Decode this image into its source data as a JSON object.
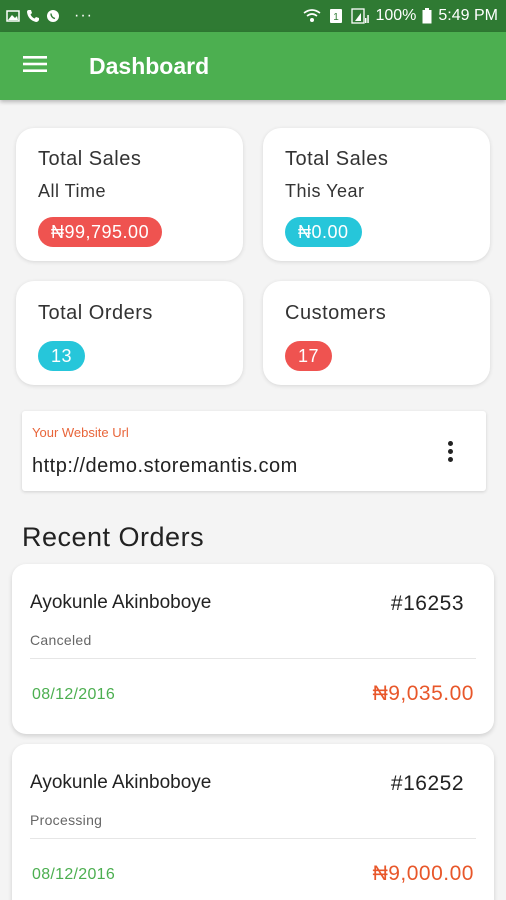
{
  "status_bar": {
    "icons_left": [
      "image-icon",
      "phone-icon",
      "whatsapp-icon"
    ],
    "dots": "···",
    "battery": "100%",
    "time": "5:49 PM"
  },
  "app_bar": {
    "title": "Dashboard",
    "menu_icon": "hamburger-icon"
  },
  "stats": {
    "total_sales_all": {
      "title": "Total Sales",
      "subtitle": "All Time",
      "value": "₦99,795.00",
      "color": "#ef5350"
    },
    "total_sales_year": {
      "title": "Total Sales",
      "subtitle": "This Year",
      "value": "₦0.00",
      "color": "#26c6da"
    },
    "total_orders": {
      "title": "Total Orders",
      "value": "13",
      "color": "#26c6da"
    },
    "customers": {
      "title": "Customers",
      "value": "17",
      "color": "#ef5350"
    }
  },
  "website": {
    "label": "Your Website Url",
    "url": "http://demo.storemantis.com"
  },
  "recent_orders": {
    "title": "Recent Orders",
    "orders": [
      {
        "name": "Ayokunle Akinboboye",
        "number": "#16253",
        "status": "Canceled",
        "date": "08/12/2016",
        "total": "₦9,035.00"
      },
      {
        "name": "Ayokunle Akinboboye",
        "number": "#16252",
        "status": "Processing",
        "date": "08/12/2016",
        "total": "₦9,000.00"
      }
    ]
  },
  "colors": {
    "primary": "#4caf50",
    "status_bar": "#2f7a33",
    "accent": "#e8572a"
  }
}
